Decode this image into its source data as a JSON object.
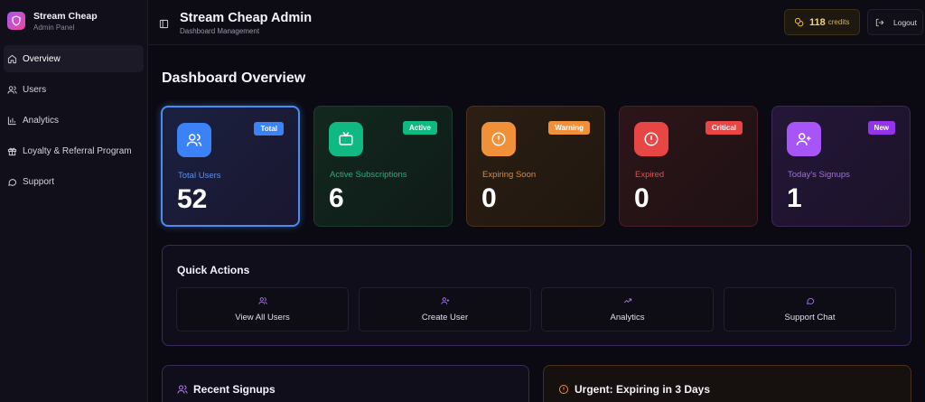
{
  "brand": {
    "name": "Stream Cheap",
    "subtitle": "Admin Panel"
  },
  "sidebar": {
    "items": [
      {
        "label": "Overview",
        "icon": "home-icon",
        "active": true
      },
      {
        "label": "Users",
        "icon": "users-icon"
      },
      {
        "label": "Analytics",
        "icon": "bar-chart-icon"
      },
      {
        "label": "Loyalty & Referral Program",
        "icon": "gift-icon"
      },
      {
        "label": "Support",
        "icon": "message-icon"
      }
    ]
  },
  "header": {
    "title": "Stream Cheap Admin",
    "subtitle": "Dashboard Management",
    "credits_value": "118",
    "credits_label": "credits",
    "logout_label": "Logout"
  },
  "main": {
    "title": "Dashboard Overview",
    "cards": [
      {
        "label": "Total Users",
        "value": "52",
        "badge": "Total",
        "color": "#3b82f6"
      },
      {
        "label": "Active Subscriptions",
        "value": "6",
        "badge": "Active",
        "color": "#10b981"
      },
      {
        "label": "Expiring Soon",
        "value": "0",
        "badge": "Warning",
        "color": "#f59e0b"
      },
      {
        "label": "Expired",
        "value": "0",
        "badge": "Critical",
        "color": "#ef4444"
      },
      {
        "label": "Today's Signups",
        "value": "1",
        "badge": "New",
        "color": "#a855f7"
      }
    ],
    "quick_actions": {
      "title": "Quick Actions",
      "items": [
        {
          "label": "View All Users",
          "icon": "users-icon"
        },
        {
          "label": "Create User",
          "icon": "user-plus-icon"
        },
        {
          "label": "Analytics",
          "icon": "trending-up-icon"
        },
        {
          "label": "Support Chat",
          "icon": "message-icon"
        }
      ]
    },
    "recent_signups": {
      "title": "Recent Signups"
    },
    "urgent": {
      "title": "Urgent: Expiring in 3 Days"
    }
  }
}
